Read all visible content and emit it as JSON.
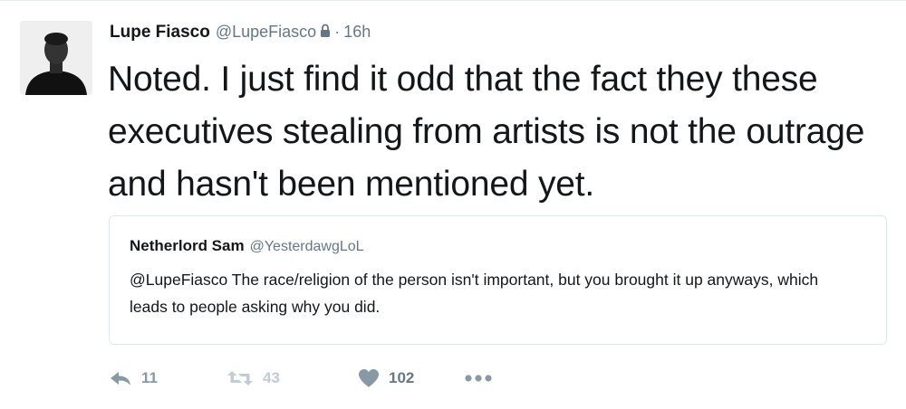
{
  "tweet": {
    "author_name": "Lupe Fiasco",
    "author_handle": "@LupeFiasco",
    "separator": "·",
    "timestamp": "16h",
    "text": "Noted. I just find it odd that the fact they these executives stealing from artists is not the outrage and hasn't been mentioned yet."
  },
  "quoted_tweet": {
    "author_name": "Netherlord Sam",
    "author_handle": "@YesterdawgLoL",
    "text": "@LupeFiasco The race/religion of the person isn't important, but you brought it up anyways, which leads to people asking why you did."
  },
  "actions": {
    "reply_count": "11",
    "retweet_count": "43",
    "like_count": "102"
  },
  "icons": {
    "lock": "lock-icon",
    "reply": "reply-icon",
    "retweet": "retweet-icon",
    "like": "heart-icon",
    "more": "more-icon"
  },
  "colors": {
    "text": "#14171a",
    "secondary": "#657786",
    "icon": "#8899a6",
    "border": "#e1e8ed"
  }
}
